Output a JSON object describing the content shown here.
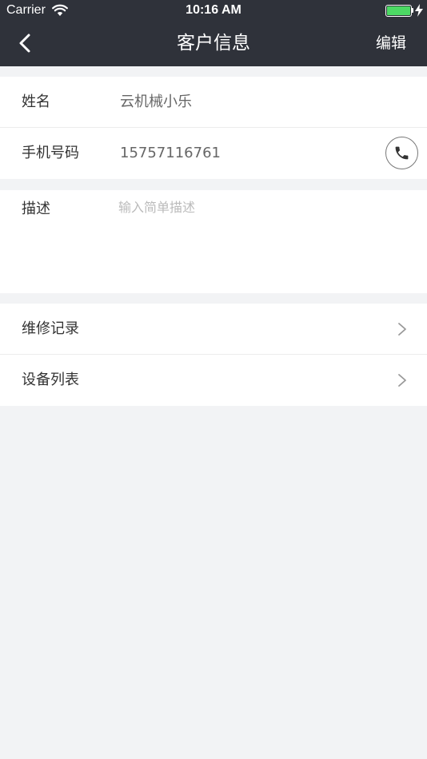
{
  "status_bar": {
    "carrier": "Carrier",
    "time": "10:16 AM"
  },
  "nav": {
    "title": "客户信息",
    "edit_label": "编辑"
  },
  "customer": {
    "name_label": "姓名",
    "name_value": "云机械小乐",
    "phone_label": "手机号码",
    "phone_value": "15757116761"
  },
  "description": {
    "label": "描述",
    "placeholder": "输入简单描述"
  },
  "links": [
    {
      "label": "维修记录"
    },
    {
      "label": "设备列表"
    }
  ],
  "colors": {
    "header_bg": "#2f323a",
    "page_bg": "#f2f3f5",
    "battery": "#4cd964"
  }
}
